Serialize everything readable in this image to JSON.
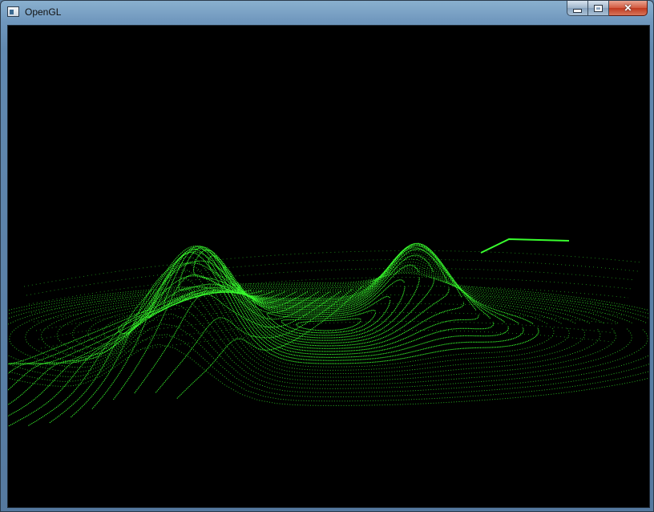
{
  "window": {
    "title": "OpenGL",
    "icon": "app-window-icon",
    "controls": {
      "minimize_icon": "minimize-icon",
      "maximize_icon": "maximize-icon",
      "close_label": "✕"
    }
  },
  "viewport": {
    "background": "#000000",
    "line_color": "#39ff2e",
    "content": "3d-wireframe-surface"
  }
}
